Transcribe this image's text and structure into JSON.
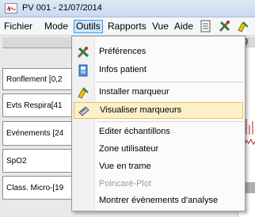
{
  "window": {
    "title": "PV 001 - 21/07/2014"
  },
  "menubar": {
    "items": [
      "Fichier",
      "Mode",
      "Outils",
      "Rapports",
      "Vue",
      "Aide"
    ],
    "active": "Outils"
  },
  "toolbar": {
    "icons": [
      "document-icon",
      "tools-icon",
      "marker-icon"
    ]
  },
  "panel": {
    "header_number": "0",
    "rows": [
      "Ronflement  [0,2",
      "Evts Respira[41",
      "Evénements [24",
      "SpO2",
      "Class. Micro-[19"
    ]
  },
  "outils_menu": {
    "items": [
      {
        "label": "Préférences",
        "icon": "preferences-tools-icon",
        "enabled": true
      },
      {
        "label": "Infos patient",
        "icon": "patient-info-icon",
        "enabled": true
      },
      {
        "label": "Installer marqueur",
        "icon": "install-marker-icon",
        "enabled": true
      },
      {
        "label": "Visualiser marqueurs",
        "icon": "view-markers-icon",
        "enabled": true,
        "highlighted": true
      },
      {
        "label": "Editer échantillons",
        "icon": "",
        "enabled": true
      },
      {
        "label": "Zone utilisateur",
        "icon": "",
        "enabled": true
      },
      {
        "label": "Vue en trame",
        "icon": "",
        "enabled": true
      },
      {
        "label": "Poincaré-Plot",
        "icon": "",
        "enabled": false
      },
      {
        "label": "Montrer évènements d'analyse",
        "icon": "",
        "enabled": true
      }
    ]
  },
  "colors": {
    "highlight_bg": "#fdf0c9",
    "highlight_border": "#e3c25b",
    "menu_active_bg": "#cce4f7",
    "menu_active_border": "#3399ff",
    "disabled_text": "#9a9a9a"
  }
}
